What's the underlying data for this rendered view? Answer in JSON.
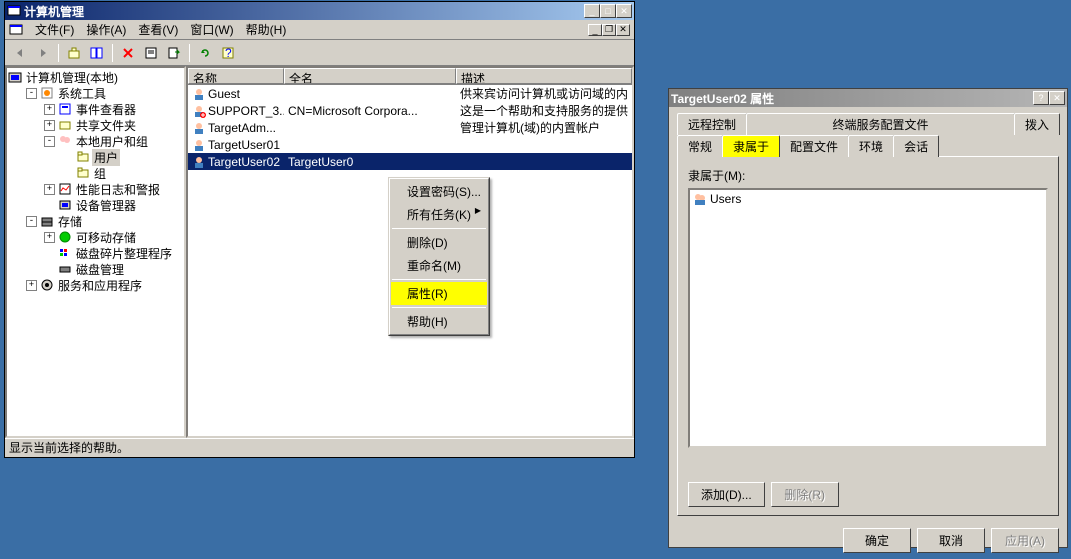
{
  "mmc": {
    "title": "计算机管理",
    "menu": {
      "file": "文件(F)",
      "action": "操作(A)",
      "view": "查看(V)",
      "window": "窗口(W)",
      "help": "帮助(H)"
    },
    "tree": {
      "root": "计算机管理(本地)",
      "systools": "系统工具",
      "eventviewer": "事件查看器",
      "shared": "共享文件夹",
      "localusers": "本地用户和组",
      "users": "用户",
      "groups": "组",
      "perflogs": "性能日志和警报",
      "devmgr": "设备管理器",
      "storage": "存储",
      "removable": "可移动存储",
      "defrag": "磁盘碎片整理程序",
      "diskmgr": "磁盘管理",
      "services": "服务和应用程序"
    },
    "columns": {
      "name": "名称",
      "fullname": "全名",
      "desc": "描述"
    },
    "rows": [
      {
        "name": "Guest",
        "fullname": "",
        "desc": "供来宾访问计算机或访问域的内"
      },
      {
        "name": "SUPPORT_3...",
        "fullname": "CN=Microsoft Corpora...",
        "desc": "这是一个帮助和支持服务的提供"
      },
      {
        "name": "TargetAdm...",
        "fullname": "",
        "desc": "管理计算机(域)的内置帐户"
      },
      {
        "name": "TargetUser01",
        "fullname": "",
        "desc": ""
      },
      {
        "name": "TargetUser02",
        "fullname": "TargetUser0",
        "desc": ""
      }
    ],
    "statusbar": "显示当前选择的帮助。"
  },
  "contextmenu": {
    "setpassword": "设置密码(S)...",
    "alltasks": "所有任务(K)",
    "delete": "删除(D)",
    "rename": "重命名(M)",
    "properties": "属性(R)",
    "help": "帮助(H)"
  },
  "dialog": {
    "title": "TargetUser02 属性",
    "tabs": {
      "remote": "远程控制",
      "tsprofile": "终端服务配置文件",
      "dialin": "拨入",
      "general": "常规",
      "memberof": "隶属于",
      "profile": "配置文件",
      "env": "环境",
      "session": "会话"
    },
    "memberof_label": "隶属于(M):",
    "member": "Users",
    "add_btn": "添加(D)...",
    "remove_btn": "删除(R)",
    "ok": "确定",
    "cancel": "取消",
    "apply": "应用(A)"
  }
}
